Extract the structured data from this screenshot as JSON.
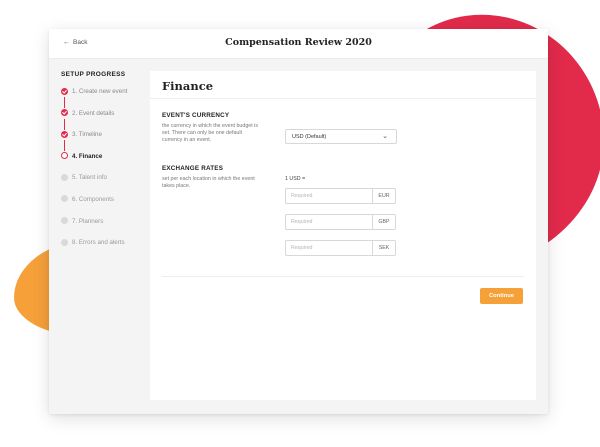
{
  "header": {
    "back_label": "Back",
    "title": "Compensation Review 2020"
  },
  "sidebar": {
    "heading": "SETUP PROGRESS",
    "steps": [
      {
        "label": "1. Create new event",
        "status": "done"
      },
      {
        "label": "2. Event details",
        "status": "done"
      },
      {
        "label": "3. Timeline",
        "status": "done"
      },
      {
        "label": "4. Finance",
        "status": "active"
      },
      {
        "label": "5. Talent info",
        "status": "pending"
      },
      {
        "label": "6. Components",
        "status": "pending"
      },
      {
        "label": "7. Planners",
        "status": "pending"
      },
      {
        "label": "8. Errors and alerts",
        "status": "pending"
      }
    ]
  },
  "main": {
    "title": "Finance",
    "currency": {
      "title": "EVENT'S CURRENCY",
      "description": "the currency in which the event budget is set. There can only be one default currency in an event.",
      "selected": "USD (Default)"
    },
    "exchange": {
      "title": "EXCHANGE RATES",
      "description": "set per each location in which the event takes place.",
      "base_label": "1 USD =",
      "rates": [
        {
          "placeholder": "Required",
          "currency": "EUR"
        },
        {
          "placeholder": "Required",
          "currency": "GBP"
        },
        {
          "placeholder": "Required",
          "currency": "SEK"
        }
      ]
    },
    "continue_label": "Continue"
  },
  "colors": {
    "accent_red": "#e22b4b",
    "accent_orange": "#f6a03a"
  }
}
